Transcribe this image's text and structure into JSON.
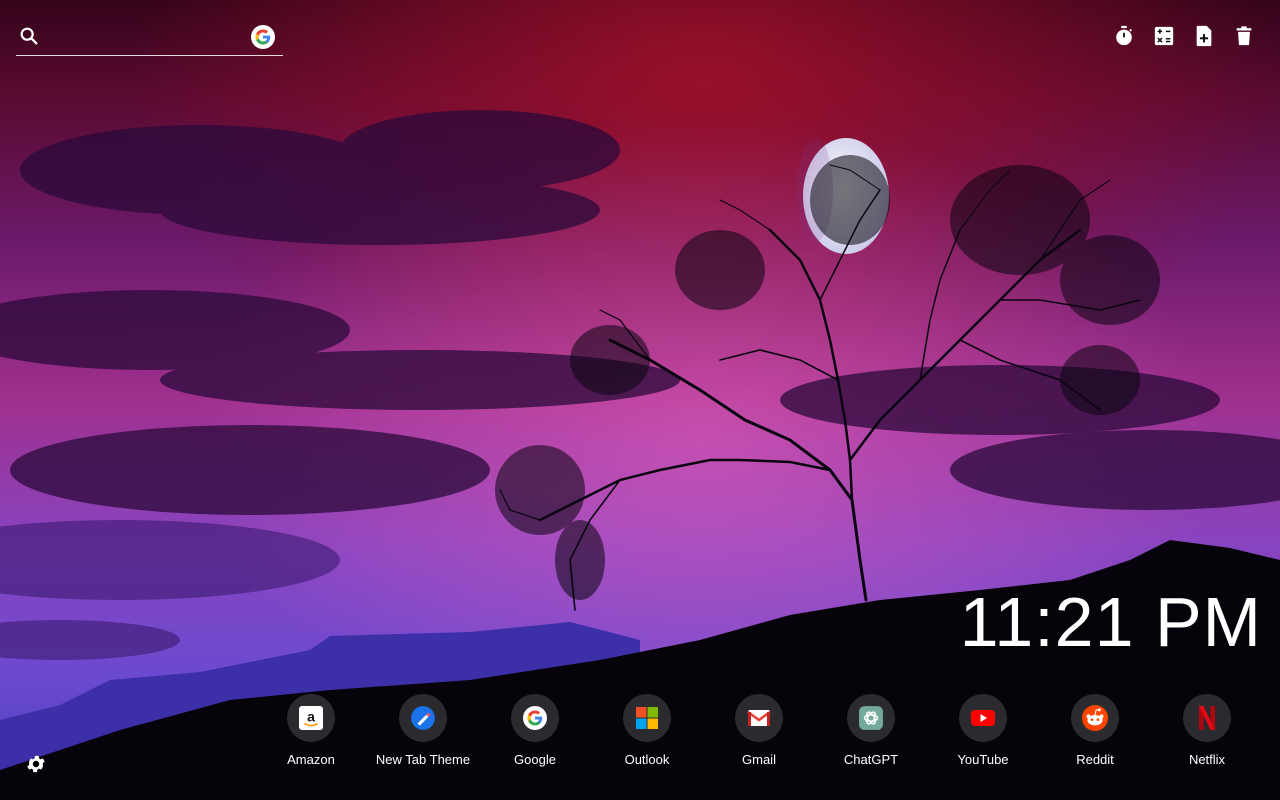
{
  "search": {
    "placeholder": "",
    "icon": "search-icon",
    "engine_icon": "google-g-icon"
  },
  "toolbar": {
    "icons": [
      "timer-icon",
      "calculator-icon",
      "add-note-icon",
      "trash-icon"
    ]
  },
  "clock": {
    "time": "11:21 PM"
  },
  "shortcuts": [
    {
      "label": "Amazon",
      "icon": "amazon-icon"
    },
    {
      "label": "New Tab Theme",
      "icon": "new-tab-theme-icon"
    },
    {
      "label": "Google",
      "icon": "google-icon"
    },
    {
      "label": "Outlook",
      "icon": "outlook-icon"
    },
    {
      "label": "Gmail",
      "icon": "gmail-icon"
    },
    {
      "label": "ChatGPT",
      "icon": "chatgpt-icon"
    },
    {
      "label": "YouTube",
      "icon": "youtube-icon"
    },
    {
      "label": "Reddit",
      "icon": "reddit-icon"
    },
    {
      "label": "Netflix",
      "icon": "netflix-icon"
    }
  ],
  "settings": {
    "icon": "gear-icon"
  },
  "colors": {
    "sky_top": "#3a0418",
    "sky_mid": "#a42a8c",
    "sky_low": "#7a3ec8",
    "tile_bg": "#2b2b2f"
  }
}
